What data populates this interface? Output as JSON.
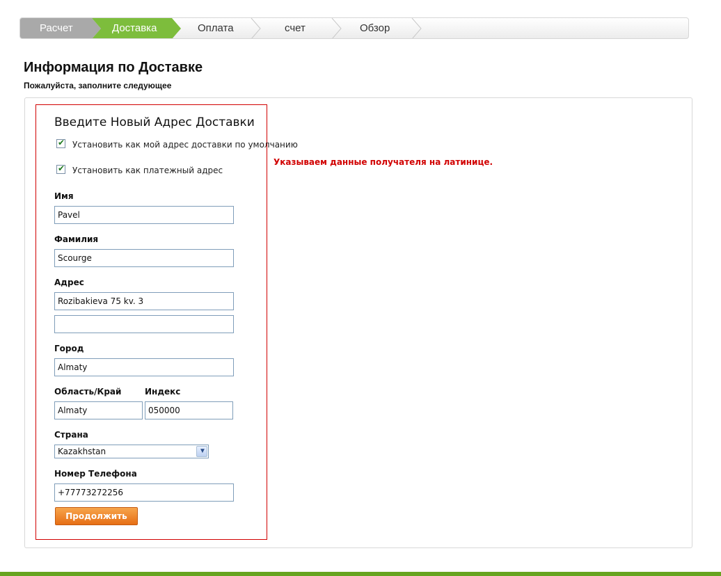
{
  "steps": [
    {
      "label": "Расчет",
      "state": "done"
    },
    {
      "label": "Доставка",
      "state": "active"
    },
    {
      "label": "Оплата",
      "state": "todo"
    },
    {
      "label": "счет",
      "state": "todo"
    },
    {
      "label": "Обзор",
      "state": "todo"
    }
  ],
  "colors": {
    "done": "#a8a8a8",
    "active": "#7dbd3c",
    "error": "#d10000",
    "button": "#f08a2c",
    "footer": "#66a41f"
  },
  "page": {
    "title": "Информация по Доставке",
    "subtitle": "Пожалуйста, заполните следующее"
  },
  "form": {
    "title": "Введите Новый Адрес Доставки",
    "default_shipping": {
      "label": "Установить как мой адрес доставки по умолчанию",
      "checked": true
    },
    "billing": {
      "label": "Установить как платежный адрес",
      "checked": true
    },
    "note": "Указываем данные получателя на латинице.",
    "first_name": {
      "label": "Имя",
      "value": "Pavel"
    },
    "last_name": {
      "label": "Фамилия",
      "value": "Scourge"
    },
    "address": {
      "label": "Адрес",
      "value1": "Rozibakieva 75 kv. 3",
      "value2": ""
    },
    "city": {
      "label": "Город",
      "value": "Almaty"
    },
    "region": {
      "label": "Область/Край",
      "value": "Almaty"
    },
    "zip": {
      "label": "Индекс",
      "value": "050000"
    },
    "country": {
      "label": "Страна",
      "value": "Kazakhstan"
    },
    "phone": {
      "label": "Номер Телефона",
      "value": "+77773272256"
    },
    "submit": "Продолжить"
  }
}
